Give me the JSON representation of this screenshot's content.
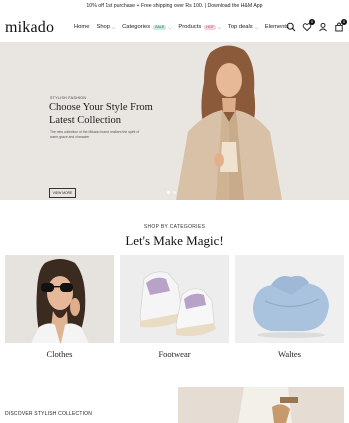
{
  "announcement": "10% off 1st purchase + Free shipping over Rs 100. | Download the H&M App",
  "header": {
    "logo": "mikado",
    "nav": [
      {
        "label": "Home",
        "chevron": false
      },
      {
        "label": "Shop",
        "chevron": true
      },
      {
        "label": "Categories",
        "chevron": true,
        "badge": "SALE",
        "badge_color": "#cde9e2"
      },
      {
        "label": "Products",
        "chevron": true,
        "badge": "HOT",
        "badge_color": "#f7d3dc"
      },
      {
        "label": "Top deals",
        "chevron": true
      },
      {
        "label": "Elements",
        "chevron": true
      }
    ],
    "icons": [
      "search-icon",
      "heart-icon",
      "user-icon",
      "bag-icon"
    ],
    "wishlist_count": "0",
    "cart_count": "0"
  },
  "hero": {
    "tag": "STYLISH FASHION",
    "title": "Choose Your Style From Latest Collection",
    "text": "The new collection of the Mikado brand realizes the spirit of warm grace and character",
    "button": "VIEW MORE",
    "background": "#e9e6e1"
  },
  "categories": {
    "subtitle": "SHOP BY CATEGORIES",
    "title": "Let's Make Magic!",
    "items": [
      {
        "label": "Clothes"
      },
      {
        "label": "Footwear"
      },
      {
        "label": "Waltes"
      }
    ]
  },
  "discover": "DISCOVER STYLISH COLLECTION"
}
